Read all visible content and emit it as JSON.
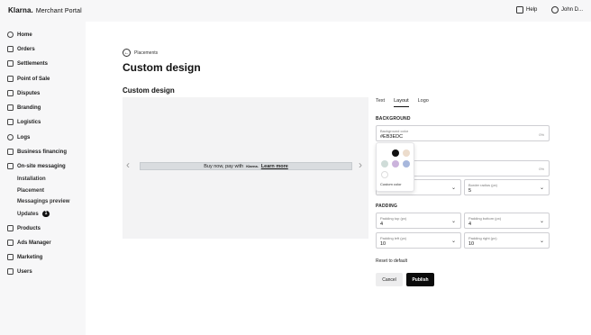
{
  "header": {
    "brand": "Klarna.",
    "portal": "Merchant Portal",
    "help_label": "Help",
    "user_label": "John D..."
  },
  "sidebar": {
    "items": [
      {
        "label": "Home",
        "icon": "home-icon"
      },
      {
        "label": "Orders",
        "icon": "orders-icon"
      },
      {
        "label": "Settlements",
        "icon": "settlements-icon"
      },
      {
        "label": "Point of Sale",
        "icon": "point-of-sale-icon"
      },
      {
        "label": "Disputes",
        "icon": "disputes-icon"
      },
      {
        "label": "Branding",
        "icon": "branding-icon"
      },
      {
        "label": "Logistics",
        "icon": "logistics-icon"
      },
      {
        "label": "Logs",
        "icon": "logs-icon"
      },
      {
        "label": "Business financing",
        "icon": "business-financing-icon"
      },
      {
        "label": "On-site messaging",
        "icon": "on-site-messaging-icon"
      }
    ],
    "subitems": [
      {
        "label": "Installation"
      },
      {
        "label": "Placement"
      },
      {
        "label": "Messagings preview"
      },
      {
        "label": "Updates",
        "badge": "1"
      }
    ],
    "items_after": [
      {
        "label": "Products",
        "icon": "products-icon"
      },
      {
        "label": "Ads Manager",
        "icon": "ads-manager-icon"
      },
      {
        "label": "Marketing",
        "icon": "marketing-icon"
      },
      {
        "label": "Users",
        "icon": "users-icon"
      }
    ]
  },
  "page": {
    "back_label": "Placements",
    "title": "Custom design",
    "section_title": "Custom design"
  },
  "preview": {
    "banner_text": "Buy now, pay with",
    "banner_brand": "Klarna.",
    "banner_link": "Learn more"
  },
  "tabs": [
    {
      "label": "Text",
      "active": false
    },
    {
      "label": "Layout",
      "active": true
    },
    {
      "label": "Logo",
      "active": false
    }
  ],
  "background": {
    "section_label": "BACKGROUND",
    "color_label": "Background color",
    "color_value": "#EB3EDC",
    "trail": "0%"
  },
  "border": {
    "trail": "0%",
    "radius_label": "Border radius (px)",
    "radius_value": "5"
  },
  "color_picker": {
    "swatches": [
      "#ffffff",
      "#111111",
      "#ecdccc",
      "#cfdcd8",
      "#b9d0c7",
      "#cbb3dc",
      "#a7b7dc",
      "#ffffff"
    ],
    "custom_label": "Custom color"
  },
  "padding": {
    "section_label": "PADDING",
    "top_label": "Padding top (px)",
    "top_value": "4",
    "bottom_label": "Padding bottom (px)",
    "bottom_value": "4",
    "left_label": "Padding left (px)",
    "left_value": "10",
    "right_label": "Padding right (px)",
    "right_value": "10"
  },
  "actions": {
    "reset_label": "Reset to default",
    "cancel_label": "Cancel",
    "publish_label": "Publish"
  }
}
